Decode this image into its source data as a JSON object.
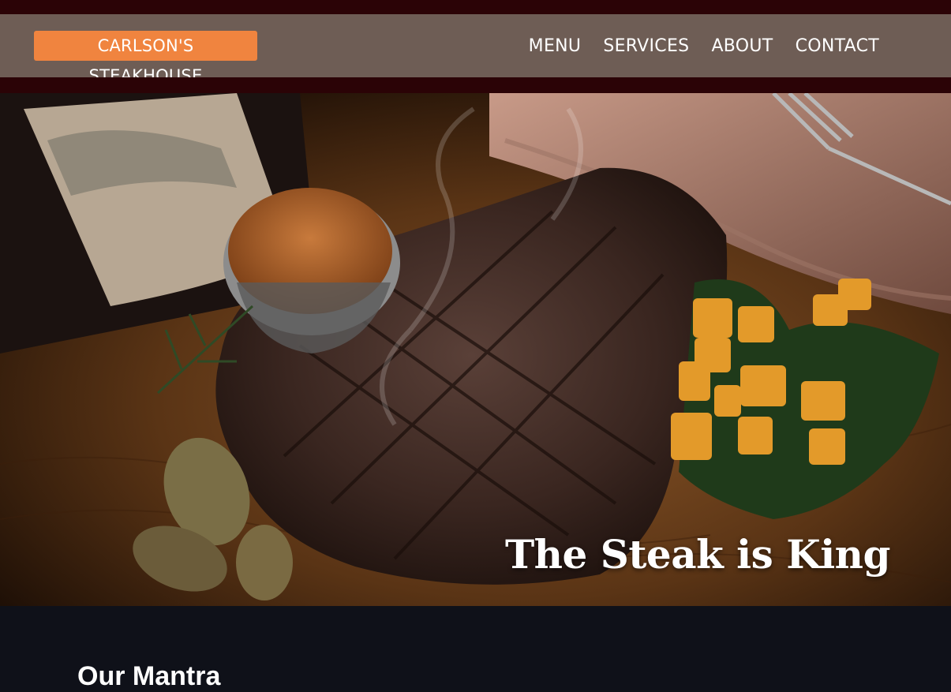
{
  "header": {
    "brand": "CARLSON'S STEAKHOUSE",
    "nav": [
      "MENU",
      "SERVICES",
      "ABOUT",
      "CONTACT"
    ]
  },
  "hero": {
    "title": "The Steak is King",
    "image": "steak-dinner-photo"
  },
  "section": {
    "heading": "Our Mantra"
  },
  "colors": {
    "top_band": "#2b0306",
    "nav_background": "#6e5d55",
    "brand_background": "#f0843f",
    "page_background": "#0f1119"
  }
}
